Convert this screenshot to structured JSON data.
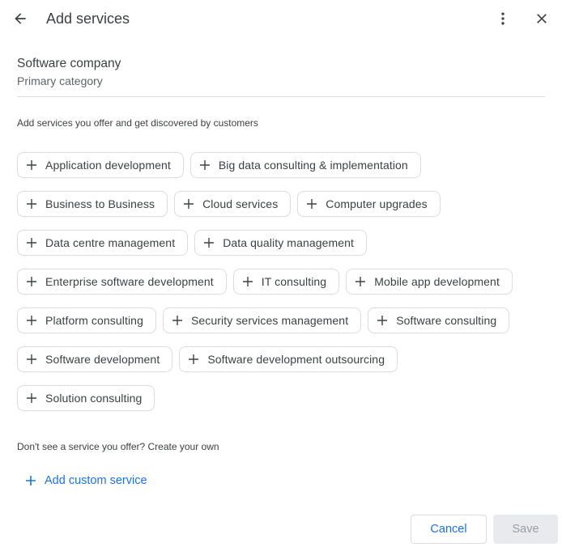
{
  "header": {
    "title": "Add services",
    "back_icon": "arrow-left-icon",
    "more_icon": "more-vert-icon",
    "close_icon": "close-icon"
  },
  "category": {
    "name": "Software company",
    "label": "Primary category"
  },
  "intro": "Add services you offer and get discovered by customers",
  "service_rows": [
    [
      "Application development",
      "Big data consulting & implementation"
    ],
    [
      "Business to Business",
      "Cloud services",
      "Computer upgrades"
    ],
    [
      "Data centre management",
      "Data quality management"
    ],
    [
      "Enterprise software development",
      "IT consulting",
      "Mobile app development"
    ],
    [
      "Platform consulting",
      "Security services management",
      "Software consulting"
    ],
    [
      "Software development",
      "Software development outsourcing"
    ],
    [
      "Solution consulting"
    ]
  ],
  "custom": {
    "prompt": "Don't see a service you offer? Create your own",
    "add_label": "Add custom service"
  },
  "actions": {
    "cancel": "Cancel",
    "save": "Save"
  },
  "colors": {
    "accent": "#1a73e8",
    "text": "#3c4043",
    "border": "#dadce0",
    "disabled_bg": "#e8eaed",
    "disabled_text": "#9aa0a6"
  }
}
